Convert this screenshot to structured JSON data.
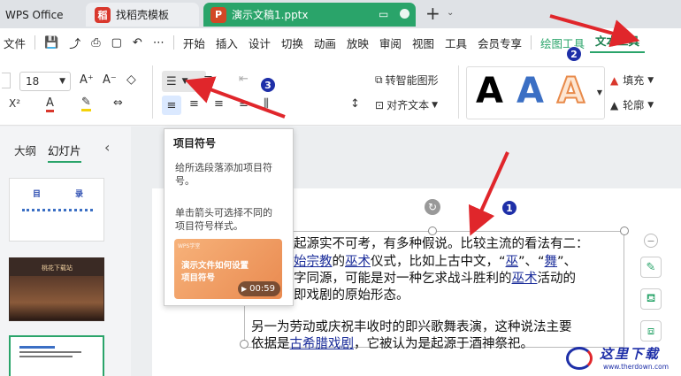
{
  "tabs": {
    "wps": "WPS Office",
    "template": "找稻壳模板",
    "doc": "演示文稿1.pptx"
  },
  "menu": {
    "file": "文件",
    "items": [
      "开始",
      "插入",
      "设计",
      "切换",
      "动画",
      "放映",
      "审阅",
      "视图",
      "工具",
      "会员专享"
    ],
    "drawing_tools": "绘图工具",
    "text_tools": "文本工具"
  },
  "ribbon": {
    "font_size": "18",
    "smart_graphic": "转智能图形",
    "align_text": "对齐文本",
    "fill": "填充",
    "outline": "轮廓",
    "style_letter": "A"
  },
  "left_pane": {
    "outline": "大纲",
    "slides": "幻灯片",
    "thumb1_title_a": "目",
    "thumb1_title_b": "录",
    "thumb2_title": "桃花下载站"
  },
  "tooltip": {
    "title": "项目符号",
    "desc1": "给所选段落添加项目符",
    "desc2": "号。",
    "hint1": "单击箭头可选择不同的",
    "hint2": "项目符号样式。",
    "video_brand": "WPS学堂",
    "video_line1": "演示文件如何设置",
    "video_line2": "项目符号",
    "video_time": "00:59"
  },
  "slide_text": {
    "l1": "起源实不可考，有多种假说。比较主流的看法有二：",
    "l2_u1": "始宗教",
    "l2_a": "的",
    "l2_u2": "巫术",
    "l2_b": "仪式，比如上古中文，“",
    "l2_u3": "巫",
    "l2_c": "”、“",
    "l2_u4": "舞",
    "l2_d": "”、",
    "l3_a": "字同源，可能是对一种乞求战斗胜利的",
    "l3_u": "巫术",
    "l3_b": "活动的",
    "l4": "即戏剧的原始形态。",
    "l5": "另一为劳动或庆祝丰收时的即兴歌舞表演，这种说法主要",
    "l6_a": "依据是",
    "l6_u": "古希腊戏剧",
    "l6_b": "，它被认为是起源于酒神祭祀。"
  },
  "badges": [
    "1",
    "2",
    "3"
  ],
  "watermark": {
    "name": "这里下载",
    "url": "www.therdown.com"
  },
  "colors": {
    "accent": "#2aa46a",
    "arrow": "#e0262b",
    "badge": "#1e2fa8",
    "wps_red": "#d9382d",
    "ppt_orange": "#d24726"
  }
}
